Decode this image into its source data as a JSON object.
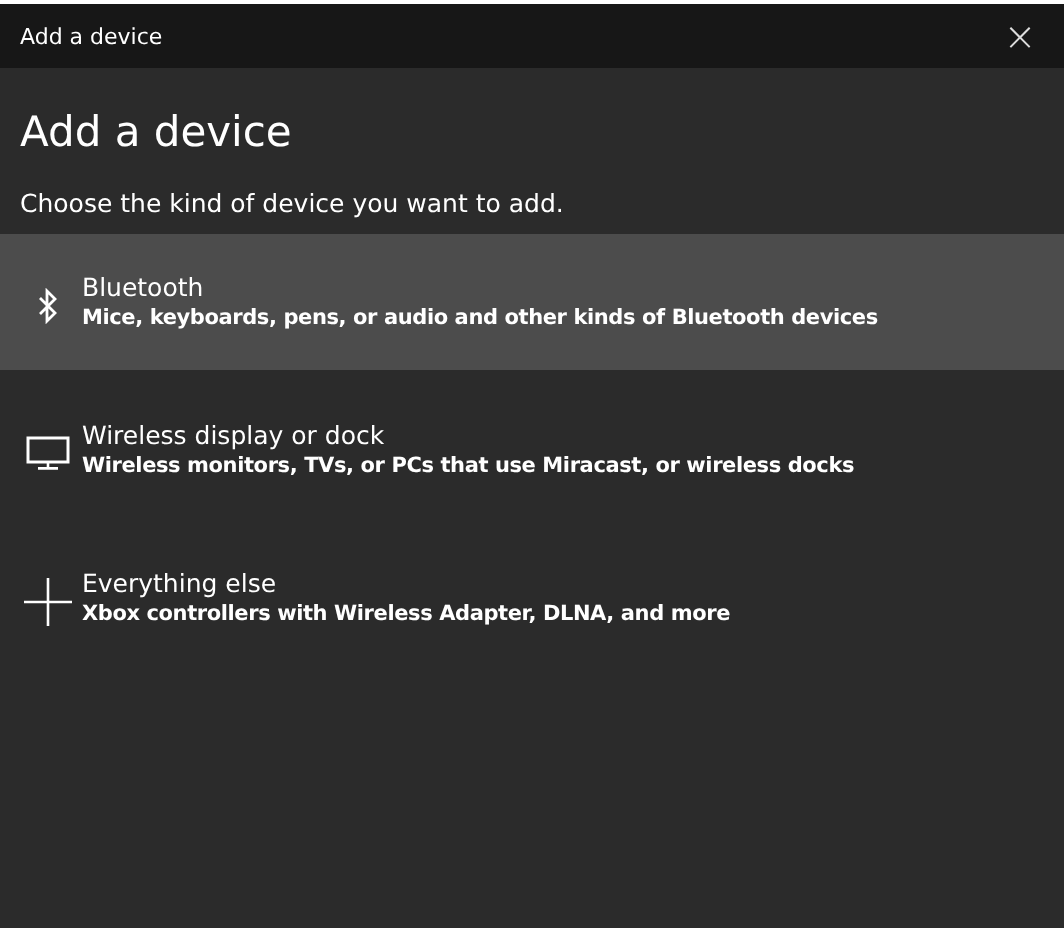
{
  "window": {
    "title": "Add a device",
    "close": "×"
  },
  "heading": "Add a device",
  "subtitle": "Choose the kind of device you want to add.",
  "options": [
    {
      "kind": "bluetooth",
      "title": "Bluetooth",
      "description": "Mice, keyboards, pens, or audio and other kinds of Bluetooth devices",
      "selected": true
    },
    {
      "kind": "display",
      "title": "Wireless display or dock",
      "description": "Wireless monitors, TVs, or PCs that use Miracast, or wireless docks",
      "selected": false
    },
    {
      "kind": "other",
      "title": "Everything else",
      "description": "Xbox controllers with Wireless Adapter, DLNA, and more",
      "selected": false
    }
  ]
}
